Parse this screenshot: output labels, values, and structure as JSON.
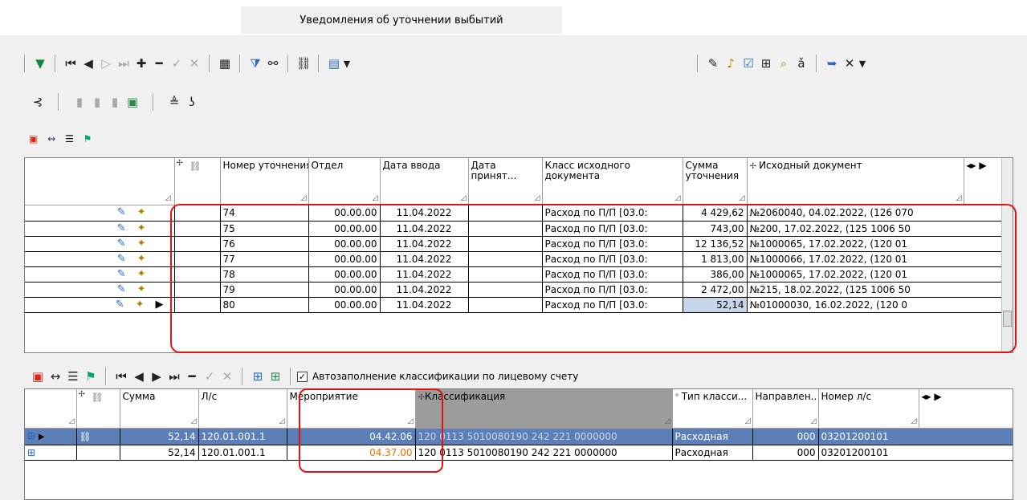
{
  "tab": {
    "title": "Уведомления об уточнении выбытий"
  },
  "toolbar1_left": [
    "filter-green-icon",
    "first-icon",
    "prev-icon",
    "next-icon",
    "last-icon",
    "add-icon",
    "remove-icon",
    "confirm-icon",
    "cancel-icon",
    "calculator-icon",
    "funnel-icon",
    "binoculars-icon",
    "link-icon",
    "export-icon",
    "dropdown-icon"
  ],
  "toolbar1_right": [
    "edit-icon",
    "bell-icon",
    "check-icon",
    "calendar-icon",
    "search-doc-icon",
    "case-icon",
    "exit-icon",
    "close-icon",
    "dropdown-icon"
  ],
  "toolbar2": [
    "tree-icon",
    "doc1-icon",
    "doc2-icon",
    "doc3-icon",
    "doc-green-icon",
    "sign-icon",
    "glasses-icon"
  ],
  "upper_grid": {
    "columns": [
      "Номер уточнения",
      "Отдел",
      "Дата ввода",
      "Дата принят...",
      "Класс исходного документа",
      "Сумма уточнения",
      "Исходный документ"
    ],
    "rows": [
      {
        "num": "74",
        "dept": "00.00.00",
        "date": "11.04.2022",
        "accepted": "",
        "cls": "Расход по П/П [03.0:",
        "sum": "4 429,62",
        "doc": "№2060040, 04.02.2022, (126 070"
      },
      {
        "num": "75",
        "dept": "00.00.00",
        "date": "11.04.2022",
        "accepted": "",
        "cls": "Расход по П/П [03.0:",
        "sum": "743,00",
        "doc": "№200, 17.02.2022, (125 1006 50"
      },
      {
        "num": "76",
        "dept": "00.00.00",
        "date": "11.04.2022",
        "accepted": "",
        "cls": "Расход по П/П [03.0:",
        "sum": "12 136,52",
        "doc": "№1000065, 17.02.2022, (120 01"
      },
      {
        "num": "77",
        "dept": "00.00.00",
        "date": "11.04.2022",
        "accepted": "",
        "cls": "Расход по П/П [03.0:",
        "sum": "1 813,00",
        "doc": "№1000066, 17.02.2022, (120 01"
      },
      {
        "num": "78",
        "dept": "00.00.00",
        "date": "11.04.2022",
        "accepted": "",
        "cls": "Расход по П/П [03.0:",
        "sum": "386,00",
        "doc": "№1000065, 17.02.2022, (120 01"
      },
      {
        "num": "79",
        "dept": "00.00.00",
        "date": "11.04.2022",
        "accepted": "",
        "cls": "Расход по П/П [03.0:",
        "sum": "2 472,00",
        "doc": "№215, 18.02.2022, (125 1006 50"
      },
      {
        "num": "80",
        "dept": "00.00.00",
        "date": "11.04.2022",
        "accepted": "",
        "cls": "Расход по П/П [03.0:",
        "sum": "52,14",
        "doc": "№01000030, 16.02.2022, (120 0"
      }
    ]
  },
  "lower": {
    "autofill_label": "Автозаполнение классификации по лицевому счету",
    "autofill_checked": true,
    "columns": [
      "Сумма",
      "Л/с",
      "Мероприятие",
      "Классификация",
      "Тип класси...",
      "Направлен..",
      "Номер л/с"
    ],
    "rows": [
      {
        "sum": "52,14",
        "ls": "120.01.001.1",
        "event": "04.42.06",
        "cls": "120 0113 5010080190 242 221 0000000",
        "type": "Расходная",
        "dir": "000",
        "lsnum": "03201200101"
      },
      {
        "sum": "52,14",
        "ls": "120.01.001.1",
        "event": "04.37.00",
        "cls": "120 0113 5010080190 242 221 0000000",
        "type": "Расходная",
        "dir": "000",
        "lsnum": "03201200101"
      }
    ]
  },
  "colors": {
    "selection": "#5b7fb6",
    "highlight": "#e11414",
    "orange_value": "#f07000"
  }
}
